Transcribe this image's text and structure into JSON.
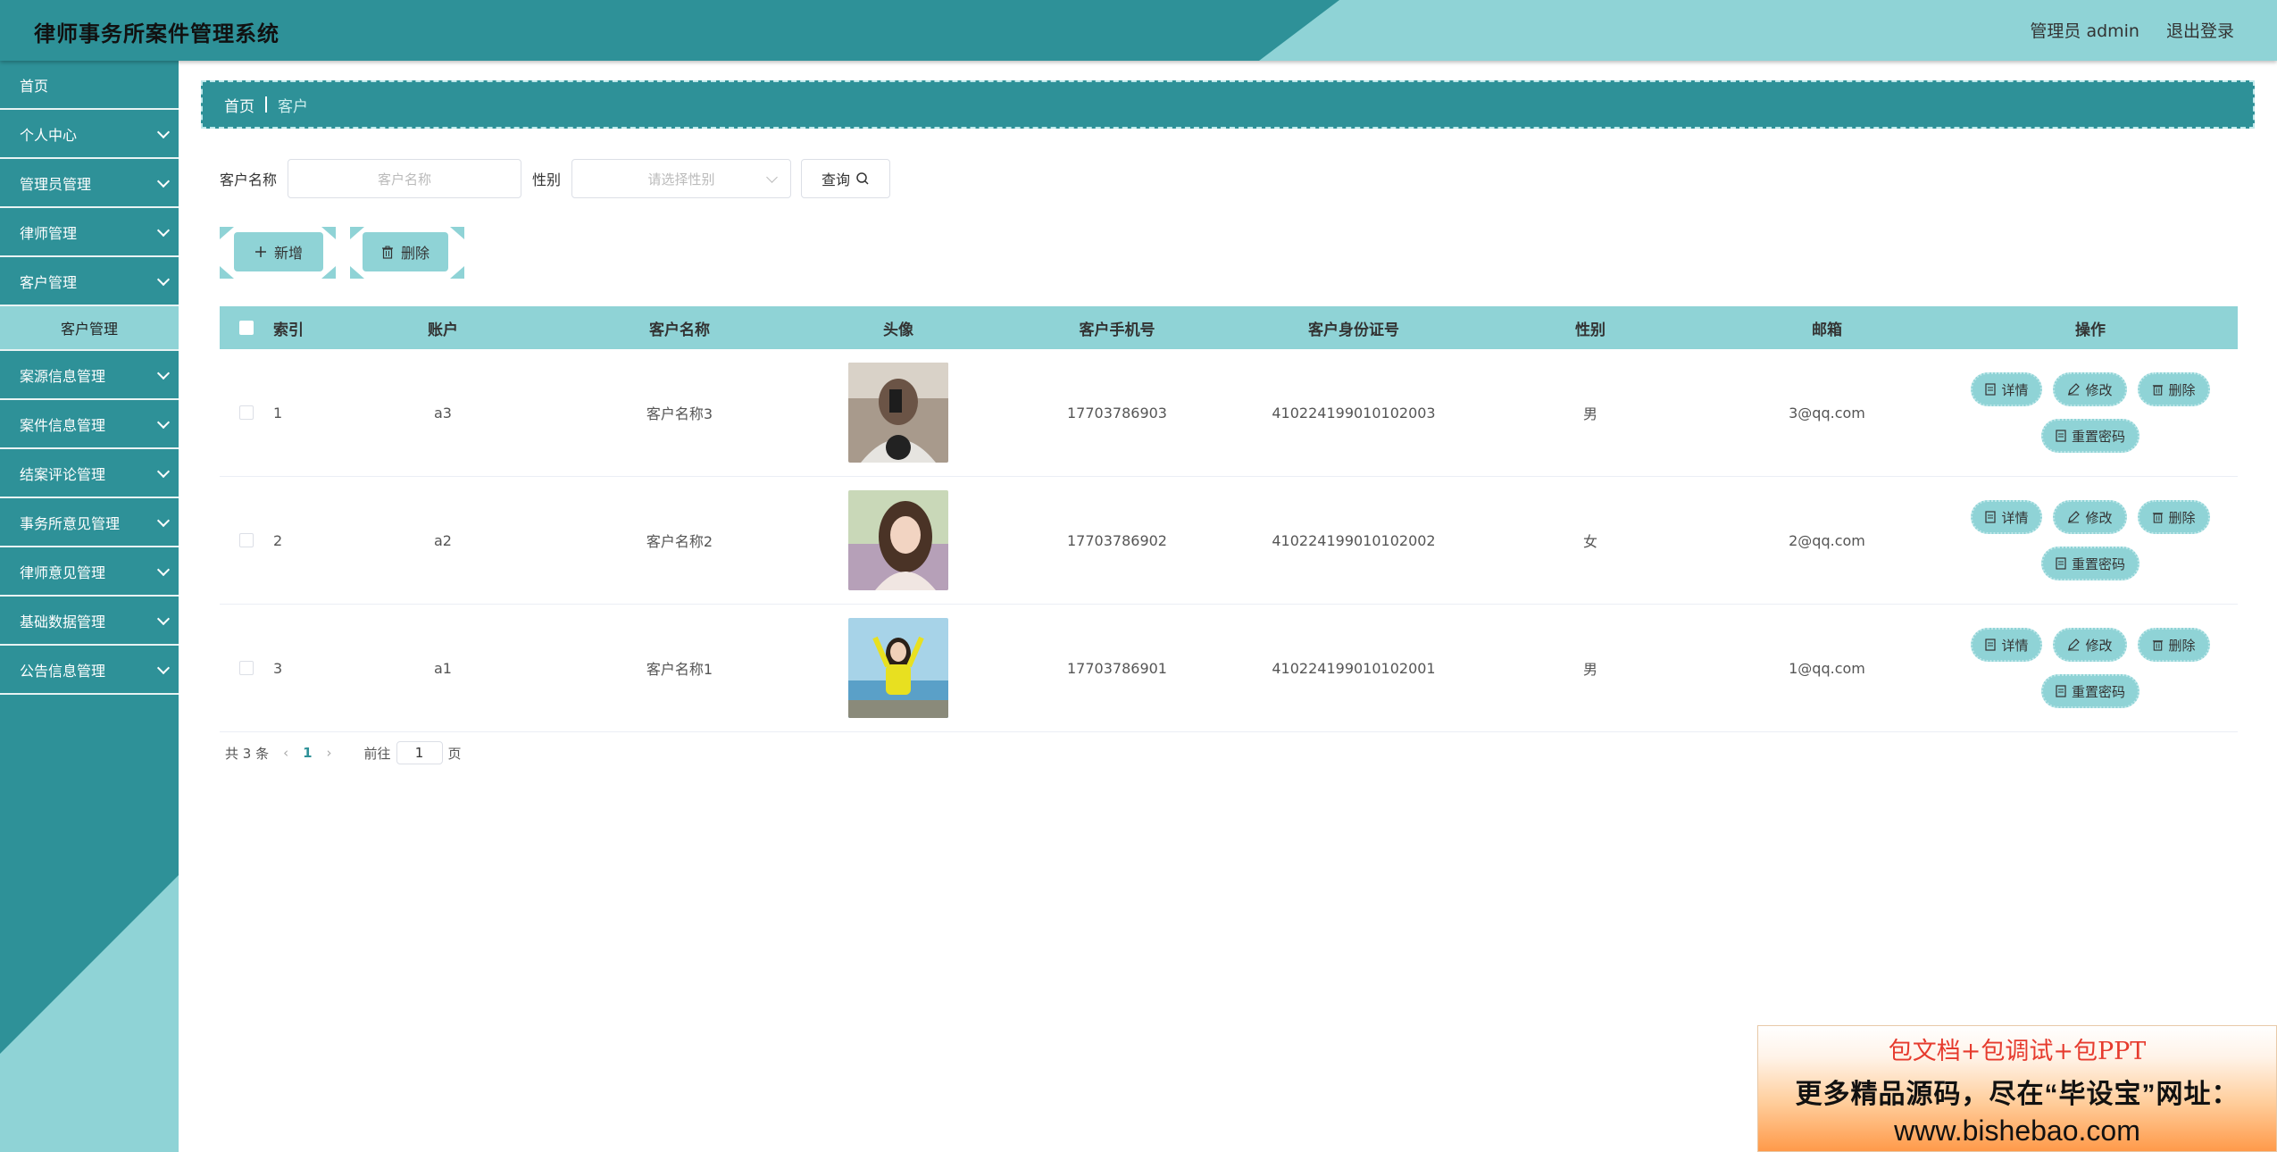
{
  "header": {
    "title": "律师事务所案件管理系统",
    "user": "管理员 admin",
    "logout": "退出登录"
  },
  "colors": {
    "primary": "#2e9198",
    "light": "#8fd3d6"
  },
  "sidebar": {
    "items": [
      {
        "label": "首页"
      },
      {
        "label": "个人中心"
      },
      {
        "label": "管理员管理"
      },
      {
        "label": "律师管理"
      },
      {
        "label": "客户管理"
      },
      {
        "label": "案源信息管理"
      },
      {
        "label": "案件信息管理"
      },
      {
        "label": "结案评论管理"
      },
      {
        "label": "事务所意见管理"
      },
      {
        "label": "律师意见管理"
      },
      {
        "label": "基础数据管理"
      },
      {
        "label": "公告信息管理"
      }
    ],
    "submenu": {
      "label": "客户管理"
    }
  },
  "breadcrumb": {
    "home": "首页",
    "current": "客户"
  },
  "search": {
    "name_label": "客户名称",
    "name_placeholder": "客户名称",
    "sex_label": "性别",
    "sex_placeholder": "请选择性别",
    "query_label": "查询"
  },
  "actions": {
    "add_label": "新增",
    "delete_label": "删除"
  },
  "table": {
    "headers": [
      "索引",
      "账户",
      "客户名称",
      "头像",
      "客户手机号",
      "客户身份证号",
      "性别",
      "邮箱",
      "操作"
    ],
    "rows": [
      {
        "index": "1",
        "account": "a3",
        "name": "客户名称3",
        "phone": "17703786903",
        "id_number": "410224199010102003",
        "sex": "男",
        "email": "3@qq.com"
      },
      {
        "index": "2",
        "account": "a2",
        "name": "客户名称2",
        "phone": "17703786902",
        "id_number": "410224199010102002",
        "sex": "女",
        "email": "2@qq.com"
      },
      {
        "index": "3",
        "account": "a1",
        "name": "客户名称1",
        "phone": "17703786901",
        "id_number": "410224199010102001",
        "sex": "男",
        "email": "1@qq.com"
      }
    ],
    "ops": {
      "detail": "详情",
      "edit": "修改",
      "delete": "删除",
      "reset": "重置密码"
    }
  },
  "pagination": {
    "total": "共 3 条",
    "current": "1",
    "goto_label": "前往",
    "goto_value": "1",
    "page_suffix": "页"
  },
  "ad": {
    "line1": "包文档+包调试+包PPT",
    "line2": "更多精品源码，尽在“毕设宝”网址：",
    "line3": "www.bishebao.com"
  }
}
